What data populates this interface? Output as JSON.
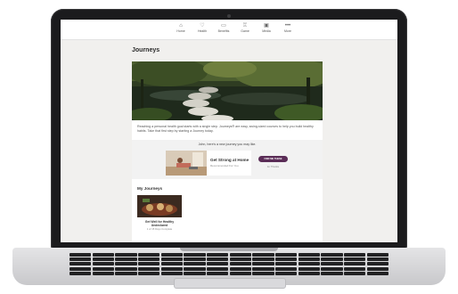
{
  "nav": {
    "items": [
      {
        "label": "Home",
        "icon": "home-icon"
      },
      {
        "label": "Health",
        "icon": "heart-icon"
      },
      {
        "label": "Benefits",
        "icon": "briefcase-icon"
      },
      {
        "label": "Game",
        "icon": "trophy-icon"
      },
      {
        "label": "Media",
        "icon": "media-icon"
      },
      {
        "label": "More",
        "icon": "more-dots-icon"
      }
    ]
  },
  "page": {
    "title": "Journeys",
    "intro": "Reaching a personal health goal starts with a single step. Journeys® are easy, swing-sized courses to help you build healthy habits. Take that first step by starting a Journey today."
  },
  "suggestion": {
    "prompt": "John, here's a new journey you may like.",
    "title": "Get Strong at Home",
    "subtitle": "Recommended For You",
    "button": "FIND ME THESE",
    "button_sub": "for Thanks"
  },
  "my_journeys": {
    "title": "My Journeys",
    "items": [
      {
        "name": "Get Well for Healthy Undeclared",
        "progress": "1 of 15 Days Complete"
      }
    ]
  },
  "colors": {
    "accent": "#5b2d57",
    "screen_bg": "#f1f0ee",
    "laptop_frame": "#1b1b1d"
  }
}
